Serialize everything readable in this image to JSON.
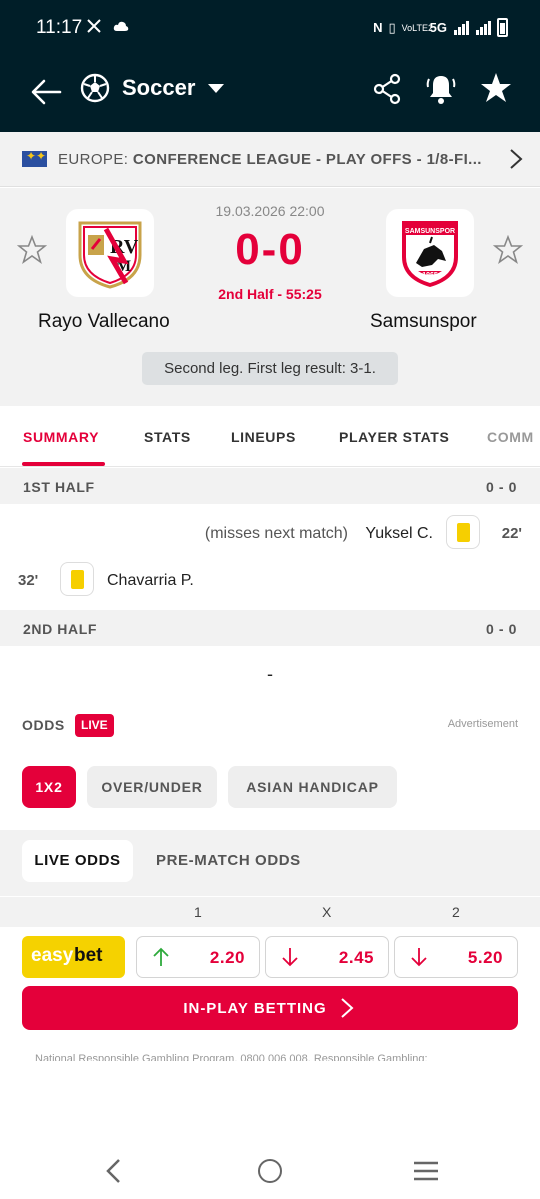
{
  "status_bar": {
    "time": "11:17",
    "right_icons": [
      "nfc-icon",
      "vibrate-icon",
      "volte-icon",
      "5g-signal-icon",
      "signal-icon",
      "battery-icon"
    ],
    "network": "5G",
    "volte": "VoLTE2"
  },
  "app_bar": {
    "title": "Soccer"
  },
  "league": {
    "country": "EUROPE:",
    "name": "CONFERENCE LEAGUE - PLAY OFFS - 1/8-FI..."
  },
  "match": {
    "datetime": "19.03.2026 22:00",
    "score": "0-0",
    "status": "2nd Half - 55:25",
    "home_team": "Rayo Vallecano",
    "away_team": "Samsunspor",
    "info": "Second leg. First leg result: 3-1."
  },
  "tabs": [
    "SUMMARY",
    "STATS",
    "LINEUPS",
    "PLAYER STATS",
    "COMM"
  ],
  "summary": {
    "first_half": {
      "label": "1ST HALF",
      "score": "0 - 0"
    },
    "events_first_half": [
      {
        "side": "away",
        "minute": "22'",
        "player": "Yuksel C.",
        "note": "(misses next match)",
        "type": "yellow-card"
      },
      {
        "side": "home",
        "minute": "32'",
        "player": "Chavarria P.",
        "note": "",
        "type": "yellow-card"
      }
    ],
    "second_half": {
      "label": "2ND HALF",
      "score": "0 - 0"
    },
    "second_half_placeholder": "-"
  },
  "odds": {
    "label": "ODDS",
    "live_badge": "LIVE",
    "advertisement": "Advertisement",
    "filters": [
      "1X2",
      "OVER/UNDER",
      "ASIAN HANDICAP"
    ],
    "types": [
      "LIVE ODDS",
      "PRE-MATCH ODDS"
    ],
    "columns": [
      "1",
      "X",
      "2"
    ],
    "bookmaker": {
      "part1": "easy",
      "part2": "bet"
    },
    "values": [
      {
        "value": "2.20",
        "trend": "up"
      },
      {
        "value": "2.45",
        "trend": "down"
      },
      {
        "value": "5.20",
        "trend": "down"
      }
    ],
    "in_play_label": "IN-PLAY BETTING",
    "disclaimer": "National Responsible Gambling Program. 0800 006 008. Responsible Gambling:"
  },
  "colors": {
    "header_bg": "#001e28",
    "accent": "#e4003a",
    "yellow_card": "#f6cf00",
    "up": "#2eaa3c",
    "down": "#e4003a"
  }
}
